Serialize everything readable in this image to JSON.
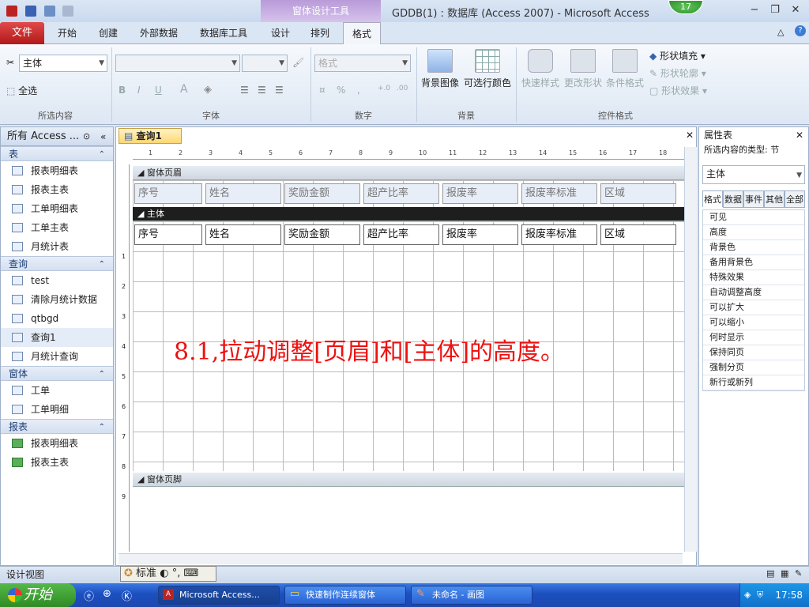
{
  "window": {
    "title": "GDDB(1) : 数据库 (Access 2007)  -  Microsoft Access",
    "context_tab_group": "窗体设计工具",
    "badge": "17",
    "controls": [
      "minimize-icon",
      "restore-icon",
      "close-icon"
    ]
  },
  "ribbon_tabs": {
    "file": "文件",
    "tabs": [
      "开始",
      "创建",
      "外部数据",
      "数据库工具",
      "设计",
      "排列",
      "格式"
    ],
    "active": "格式"
  },
  "ribbon": {
    "selection": {
      "object_combo": "主体",
      "select_all": "全选",
      "label": "所选内容"
    },
    "font": {
      "label": "字体",
      "bold": "B",
      "italic": "I",
      "underline": "U",
      "font_color": "A"
    },
    "number": {
      "format_combo": "格式",
      "percent": "%",
      "comma": ",",
      "label": "数字"
    },
    "background": {
      "bg_image": "背景图像",
      "alt_color": "可选行颜色",
      "label": "背景"
    },
    "control_format": {
      "quick_styles": "快速样式",
      "change_shape": "更改形状",
      "cond_format": "条件格式",
      "shape_fill": "形状填充",
      "shape_outline": "形状轮廓",
      "shape_effects": "形状效果",
      "label": "控件格式"
    }
  },
  "nav": {
    "header": "所有 Access ...",
    "sections": [
      {
        "title": "表",
        "items": [
          "报表明细表",
          "报表主表",
          "工单明细表",
          "工单主表",
          "月统计表"
        ]
      },
      {
        "title": "查询",
        "items": [
          "test",
          "清除月统计数据",
          "qtbgd",
          "查询1",
          "月统计查询"
        ]
      },
      {
        "title": "窗体",
        "items": [
          "工单",
          "工单明细"
        ]
      },
      {
        "title": "报表",
        "items": [
          "报表明细表",
          "报表主表"
        ]
      }
    ],
    "selected": "查询1"
  },
  "document": {
    "tab": "查询1",
    "header_band": "窗体页眉",
    "detail_band": "主体",
    "footer_band": "窗体页脚",
    "fields": [
      "序号",
      "姓名",
      "奖励金额",
      "超产比率",
      "报废率",
      "报废率标准",
      "区域"
    ],
    "ruler_marks": [
      "1",
      "2",
      "3",
      "4",
      "5",
      "6",
      "7",
      "8",
      "9",
      "10",
      "11",
      "12",
      "13",
      "14",
      "15",
      "16",
      "17",
      "18"
    ],
    "vruler_marks": [
      "1",
      "2",
      "3",
      "4",
      "5",
      "6",
      "7",
      "8",
      "9"
    ]
  },
  "overlay_text": "8.1,拉动调整[页眉]和[主体]的高度。",
  "property_sheet": {
    "title": "属性表",
    "type_label": "所选内容的类型: 节",
    "selected_object": "主体",
    "tabs": [
      "格式",
      "数据",
      "事件",
      "其他",
      "全部"
    ],
    "active_tab": "格式",
    "rows": [
      "可见",
      "高度",
      "背景色",
      "备用背景色",
      "特殊效果",
      "自动调整高度",
      "可以扩大",
      "可以缩小",
      "何时显示",
      "保持同页",
      "强制分页",
      "新行或新列"
    ]
  },
  "status": {
    "view": "设计视图",
    "ime": "标准"
  },
  "taskbar": {
    "start": "开始",
    "tasks": [
      "Microsoft Access...",
      "快速制作连续窗体",
      "未命名 - 画图"
    ],
    "clock": "17:58"
  },
  "colors": {
    "file_tab": "#c0201f",
    "context": "#b89ad8",
    "overlay": "#ee1111",
    "taskbar": "#2458c6"
  }
}
